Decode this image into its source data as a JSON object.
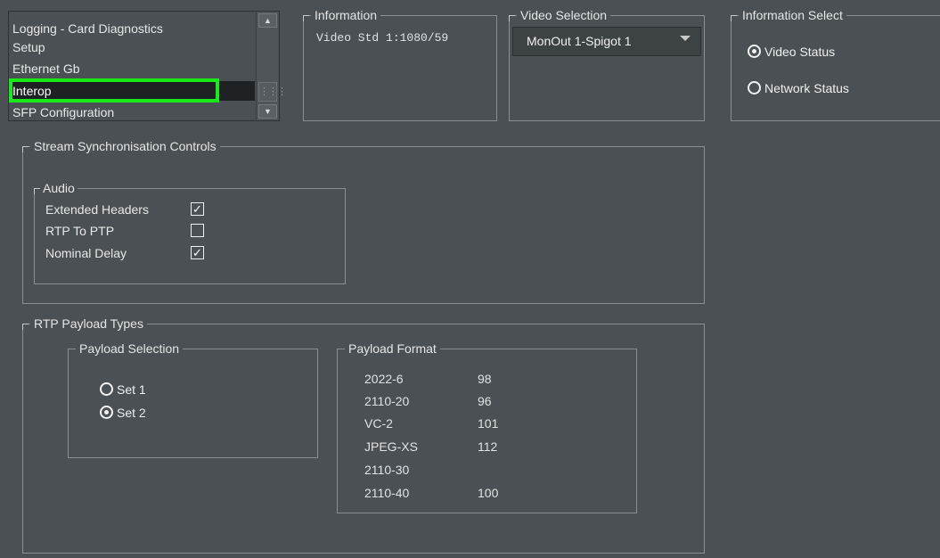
{
  "nav": {
    "items": [
      {
        "label": "Logging - Card Diagnostics",
        "selected": false
      },
      {
        "label": "Setup",
        "selected": false
      },
      {
        "label": "Ethernet Gb",
        "selected": false
      },
      {
        "label": "Interop",
        "selected": true
      },
      {
        "label": "SFP Configuration",
        "selected": false
      }
    ]
  },
  "information": {
    "title": "Information",
    "text": "Video Std 1:1080/59"
  },
  "video_selection": {
    "title": "Video Selection",
    "value": "MonOut 1-Spigot 1"
  },
  "information_select": {
    "title": "Information Select",
    "options": [
      {
        "label": "Video Status",
        "checked": true
      },
      {
        "label": "Network Status",
        "checked": false
      }
    ]
  },
  "stream_sync": {
    "title": "Stream Synchronisation Controls",
    "audio": {
      "title": "Audio",
      "items": [
        {
          "label": "Extended Headers",
          "checked": true
        },
        {
          "label": "RTP To PTP",
          "checked": false
        },
        {
          "label": "Nominal Delay",
          "checked": true
        }
      ]
    }
  },
  "rtp_payload": {
    "title": "RTP Payload Types",
    "selection": {
      "title": "Payload Selection",
      "options": [
        {
          "label": "Set 1",
          "checked": false
        },
        {
          "label": "Set 2",
          "checked": true
        }
      ]
    },
    "format": {
      "title": "Payload Format",
      "rows": [
        {
          "name": "2022-6",
          "value": "98"
        },
        {
          "name": "2110-20",
          "value": "96"
        },
        {
          "name": "VC-2",
          "value": "101"
        },
        {
          "name": "JPEG-XS",
          "value": "112"
        },
        {
          "name": "2110-30",
          "value": ""
        },
        {
          "name": "2110-40",
          "value": "100"
        }
      ]
    }
  },
  "colors": {
    "background": "#4a5054",
    "highlight": "#18ea18",
    "selected_row": "#1e2224"
  },
  "icons": {
    "scroll_up": "triangle-up",
    "scroll_down": "triangle-down",
    "dropdown": "triangle-down"
  }
}
